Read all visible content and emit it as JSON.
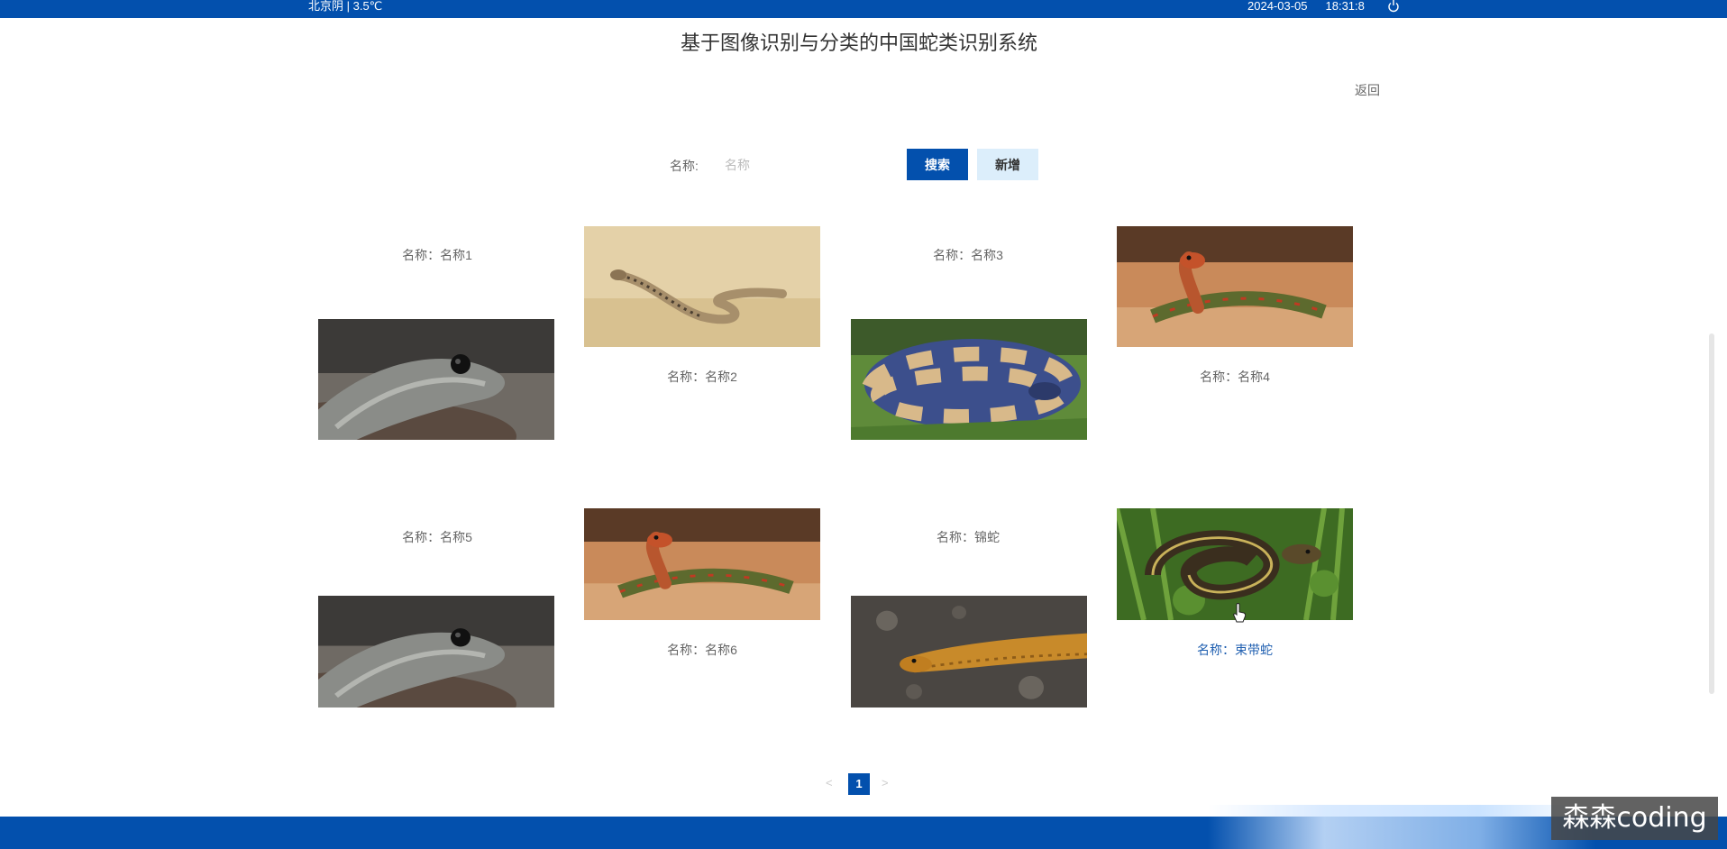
{
  "header": {
    "weather": "北京阴 | 3.5℃",
    "date": "2024-03-05",
    "time": "18:31:8",
    "power_icon": "power-icon"
  },
  "page": {
    "title": "基于图像识别与分类的中国蛇类识别系统",
    "back_label": "返回"
  },
  "search": {
    "label": "名称:",
    "placeholder": "名称",
    "search_button": "搜索",
    "add_button": "新增"
  },
  "cards": [
    {
      "label": "名称：名称1",
      "image": "black-mamba-head"
    },
    {
      "label": "名称：名称2",
      "image": "tan-snake-on-sand"
    },
    {
      "label": "名称：名称3",
      "image": "banded-blue-yellow-snake"
    },
    {
      "label": "名称：名称4",
      "image": "red-headed-green-snake"
    },
    {
      "label": "名称：名称5",
      "image": "black-mamba-head"
    },
    {
      "label": "名称：名称6",
      "image": "red-headed-green-snake"
    },
    {
      "label": "名称：锦蛇",
      "image": "orange-rat-snake-on-gravel"
    },
    {
      "label": "名称：束带蛇",
      "image": "garter-snake-in-grass"
    }
  ],
  "pagination": {
    "prev": "<",
    "current": "1",
    "next": ">"
  },
  "watermark": "森森coding",
  "colors": {
    "primary": "#0350ad",
    "secondary_button": "#dceefb",
    "hover_text": "#1f5fb0"
  }
}
